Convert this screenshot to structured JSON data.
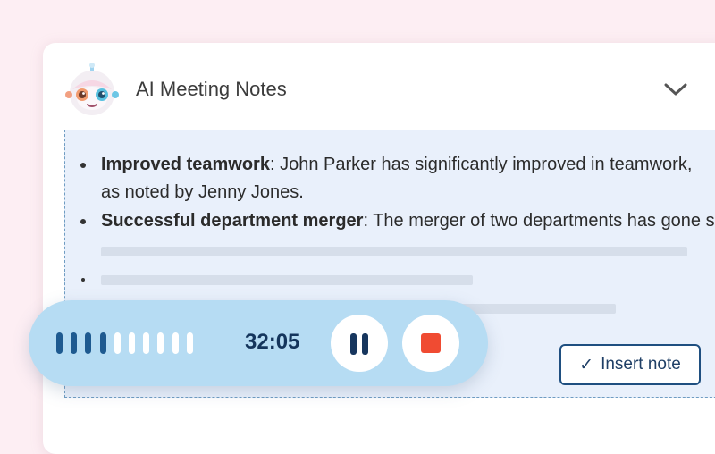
{
  "colors": {
    "page_background": "#fdeef3",
    "accent_dark": "#1f4f80",
    "recorder_background": "#b6dcf3",
    "waveform_active": "#1e5a90",
    "waveform_inactive": "#ffffff",
    "stop": "#f04b32"
  },
  "header": {
    "title": "AI Meeting Notes",
    "avatar_icon": "robot-avatar-icon",
    "collapse_icon": "chevron-down-icon"
  },
  "notes": {
    "items": [
      {
        "heading": "Improved teamwork",
        "text": ": John Parker has significantly improved in teamwork,",
        "continuation": "as noted by Jenny Jones."
      },
      {
        "heading": "Successful department merger",
        "text": ": The merger of two departments has gone smoothly"
      }
    ]
  },
  "insert_button": {
    "icon": "checkmark-icon",
    "check_glyph": "✓",
    "label": "Insert note"
  },
  "recorder": {
    "time": "32:05",
    "waveform_total_bars": 10,
    "waveform_active_bars": 4,
    "pause_icon": "pause-icon",
    "stop_icon": "stop-icon"
  }
}
